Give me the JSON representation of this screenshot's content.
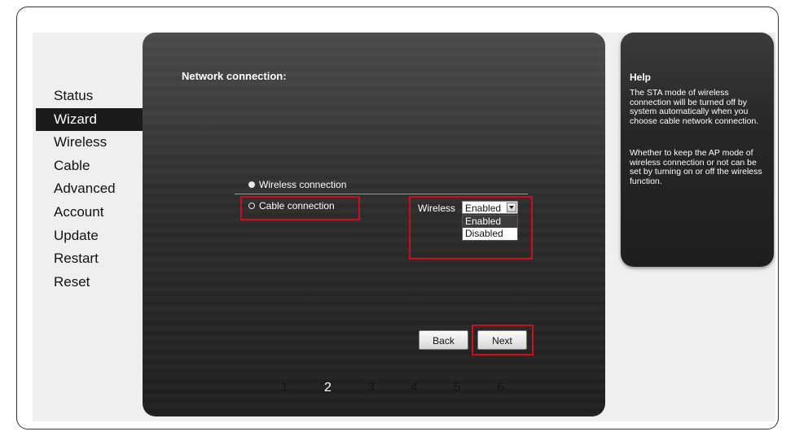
{
  "sidebar": {
    "items": [
      {
        "label": "Status"
      },
      {
        "label": "Wizard",
        "active": true
      },
      {
        "label": "Wireless"
      },
      {
        "label": "Cable"
      },
      {
        "label": "Advanced"
      },
      {
        "label": "Account"
      },
      {
        "label": "Update"
      },
      {
        "label": "Restart"
      },
      {
        "label": "Reset"
      }
    ]
  },
  "main": {
    "title": "Network connection:",
    "options": {
      "wireless": "Wireless connection",
      "cable": "Cable connection",
      "selected": "cable"
    },
    "wireless_field": {
      "label": "Wireless",
      "value": "Enabled",
      "options": [
        "Enabled",
        "Disabled"
      ],
      "highlighted_option": "Enabled"
    },
    "buttons": {
      "back": "Back",
      "next": "Next"
    },
    "steps": [
      "1",
      "2",
      "3",
      "4",
      "5",
      "6"
    ],
    "current_step": "2"
  },
  "help": {
    "title": "Help",
    "p1": "The STA mode of wireless connection will be turned off by system automatically when you choose cable network connection.",
    "p2": "Whether to keep the AP mode of wireless connection or not can be set by turning on or off the wireless function."
  },
  "colors": {
    "highlight": "#cc0f1a",
    "panel_dark": "#1f1f1f",
    "nav_active": "#1b1b1b"
  }
}
